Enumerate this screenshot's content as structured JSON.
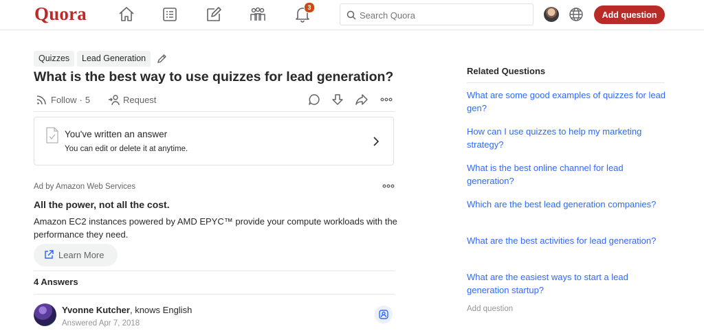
{
  "header": {
    "logo": "Quora",
    "notifications_count": "3",
    "search_placeholder": "Search Quora",
    "add_question_label": "Add question"
  },
  "question": {
    "tags": [
      "Quizzes",
      "Lead Generation"
    ],
    "title": "What is the best way to use quizzes for lead generation?",
    "follow_label": "Follow",
    "follow_count": "5",
    "request_label": "Request"
  },
  "written_answer": {
    "title": "You've written an answer",
    "subtitle": "You can edit or delete it at anytime."
  },
  "ad": {
    "label": "Ad by Amazon Web Services",
    "title": "All the power, not all the cost.",
    "body": "Amazon EC2 instances powered by AMD EPYC™ provide your compute workloads with the performance they need.",
    "cta": "Learn More"
  },
  "answers": {
    "count_label": "4 Answers",
    "first": {
      "author": "Yvonne Kutcher",
      "credential": "knows English",
      "date": "Answered Apr 7, 2018"
    }
  },
  "related": {
    "title": "Related Questions",
    "items": [
      "What are some good examples of quizzes for lead gen?",
      "How can I use quizzes to help my marketing strategy?",
      "What is the best online channel for lead generation?",
      "Which are the best lead generation companies?",
      "What are the best activities for lead generation?",
      "What are the easiest ways to start a lead generation startup?"
    ],
    "add_question": "Add question"
  },
  "colors": {
    "brand": "#b92b27",
    "link": "#2e69ff",
    "text": "#282829",
    "muted": "#636466"
  }
}
